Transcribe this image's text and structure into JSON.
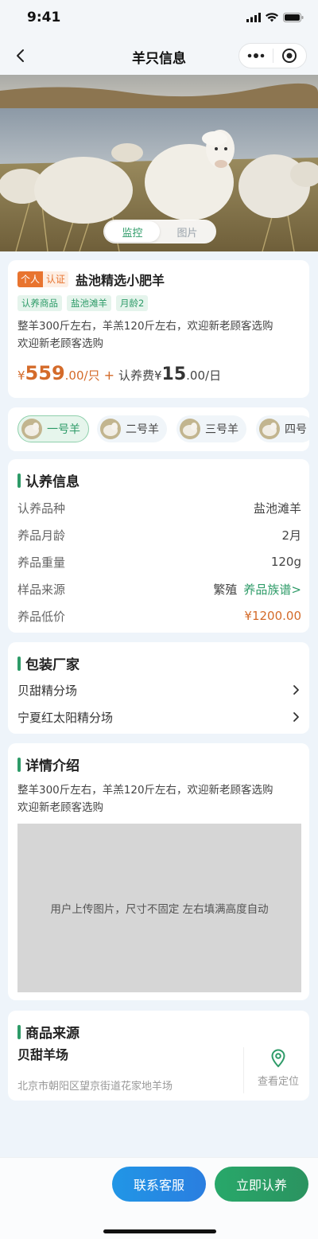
{
  "status": {
    "time": "9:41"
  },
  "nav": {
    "title": "羊只信息"
  },
  "media_tabs": [
    "监控",
    "图片"
  ],
  "product": {
    "badge_individual": "个人",
    "badge_certified": "认证",
    "name": "盐池精选小肥羊",
    "tags": [
      "认养商品",
      "盐池滩羊",
      "月龄2"
    ],
    "description_line1": "整羊300斤左右，羊羔120斤左右，欢迎新老顾客选购",
    "description_line2": "欢迎新老顾客选购",
    "price_symbol": "¥",
    "price_int": "559",
    "price_unit": ".00/只",
    "plus": "+",
    "fee_label": "认养费¥",
    "fee_int": "15",
    "fee_unit": ".00/日"
  },
  "sheep_selector": [
    {
      "label": "一号羊",
      "active": true
    },
    {
      "label": "二号羊",
      "active": false
    },
    {
      "label": "三号羊",
      "active": false
    },
    {
      "label": "四号",
      "active": false
    }
  ],
  "adopt_info": {
    "title": "认养信息",
    "rows": [
      {
        "key": "认养品种",
        "value": "盐池滩羊"
      },
      {
        "key": "养品月龄",
        "value": "2月"
      },
      {
        "key": "养品重量",
        "value": "120g"
      },
      {
        "key": "样品来源",
        "value": "繁殖",
        "link": "养品族谱>"
      },
      {
        "key": "养品低价",
        "value": "¥1200.00"
      }
    ]
  },
  "packaging": {
    "title": "包装厂家",
    "items": [
      "贝甜精分场",
      "宁夏红太阳精分场"
    ]
  },
  "details": {
    "title": "详情介绍",
    "line1": "整羊300斤左右，羊羔120斤左右，欢迎新老顾客选购",
    "line2": "欢迎新老顾客选购",
    "image_placeholder": "用户上传图片，尺寸不固定 左右填满高度自动"
  },
  "source": {
    "title": "商品来源",
    "farm": "贝甜羊场",
    "address": "北京市朝阳区望京街道花家地羊场",
    "locate": "查看定位"
  },
  "actions": {
    "contact": "联系客服",
    "adopt": "立即认养"
  },
  "colors": {
    "accent_green": "#2e9b68",
    "price_orange": "#d46b2a",
    "button_blue": "#2196e6"
  }
}
